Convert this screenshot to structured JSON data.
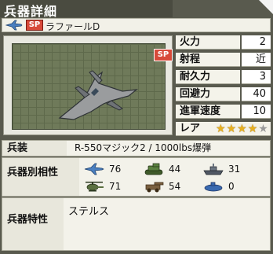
{
  "title": "兵器詳細",
  "weapon": {
    "sp_badge": "SP",
    "name": "ラファールD",
    "image_badge": "SP"
  },
  "stats": [
    {
      "label": "火力",
      "value": "2"
    },
    {
      "label": "射程",
      "value": "近"
    },
    {
      "label": "耐久力",
      "value": "3"
    },
    {
      "label": "回避力",
      "value": "40"
    },
    {
      "label": "進軍速度",
      "value": "10"
    }
  ],
  "rarity": {
    "label": "レア",
    "filled": 4,
    "total": 5,
    "star_symbol": "★"
  },
  "equipment": {
    "label": "兵装",
    "value": "R-550マジック2 / 1000lbs爆弾"
  },
  "compatibility": {
    "label": "兵器別相性",
    "items": [
      {
        "icon": "fighter-jet-icon",
        "value": "76"
      },
      {
        "icon": "tank-icon",
        "value": "44"
      },
      {
        "icon": "warship-icon",
        "value": "31"
      },
      {
        "icon": "helicopter-icon",
        "value": "71"
      },
      {
        "icon": "artillery-icon",
        "value": "54"
      },
      {
        "icon": "submarine-icon",
        "value": "0"
      }
    ]
  },
  "traits": {
    "label": "兵器特性",
    "value": "ステルス"
  },
  "colors": {
    "accent_red": "#d84a3a",
    "star_gold": "#e8b020",
    "frame": "#595a4e"
  }
}
